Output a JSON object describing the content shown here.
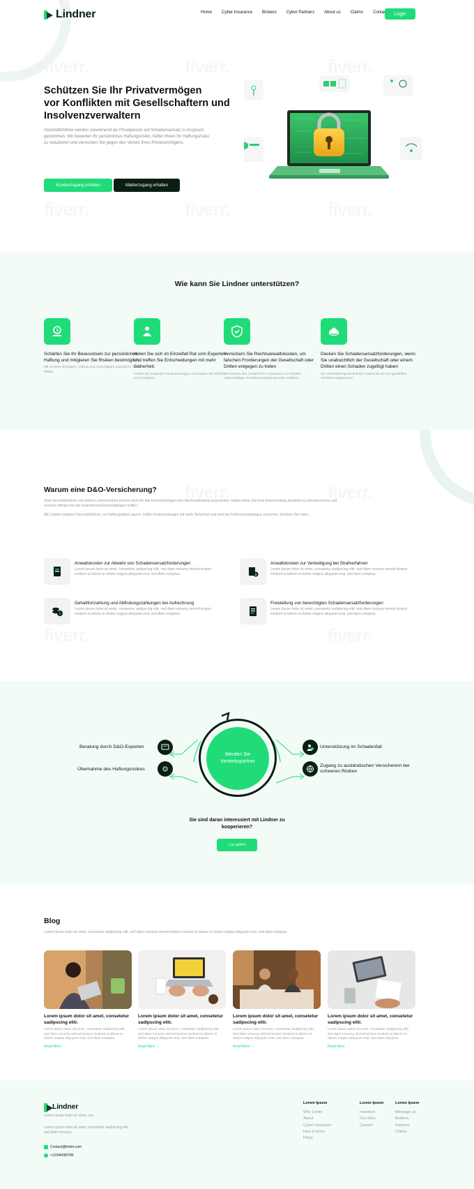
{
  "brand": {
    "name": "Lindner",
    "accent": "#1fdc78",
    "dark": "#0a1f14",
    "soft_bg": "#f3fbf7"
  },
  "nav": {
    "items": [
      "Home",
      "Cyber Insurance",
      "Brokers",
      "Cyber Partners",
      "About us",
      "Claims",
      "Contacts"
    ],
    "login": "Login"
  },
  "hero": {
    "title_lines": [
      "Schützen Sie Ihr Privatvermögen",
      "vor Konflikten mit Gesellschaftern und",
      "Insolvenzverwaltern"
    ],
    "paragraph": "Geschäftsführer werden zunehmend als Privatperson auf Schadensersatz in Anspruch genommen. Wir bewerten Ihr persönliches Haftungsrisiko, helfen Ihnen Ihr Haftungsrisiko zu reduzieren und versichern Sie gegen den Verlust Ihres Privatvermögens.",
    "btn_primary": "Kundenzugang erhalten",
    "btn_secondary": "Maklerzugang erhalten"
  },
  "help": {
    "title": "Wie kann Sie Lindner unterstützen?",
    "features": [
      {
        "title": "Schärfen Sie Ihr Bewusstsein zur persönlichen Haftung und mitigieren Sie Risiken bestmöglich.",
        "text": "Mit unseren Beiträgen, Videos und Vorschlägen reduzieren sie Ihr Risiko",
        "icon": "money-bag-icon"
      },
      {
        "title": "Holen Sie sich im Einzelfall Rat vom Experten und treffen Sie Entscheidungen mit mehr Sicherheit.",
        "text": "Finden Sie Experten mit Bewertungen und kaufen Sie einfach zum Festpreis",
        "icon": "expert-icon"
      },
      {
        "title": "Versichern Sie Rechtsanwaltskosten, um falschen Frorderungen der Gesellschaft oder Dritten entgegen zu treten",
        "text": "Sie können den Anwalt Ihres Vertrauens zur Abwehr unberechtigter Schadensersatzansprüche wählen?",
        "icon": "shield-icon"
      },
      {
        "title": "Decken Sie Schadensersatzforderungen, wenn Sie unabsichtlich der Gesellschaft oder einem Dritten einen Schaden zugefügt haben",
        "text": "Die Versicherung bezahlt die Ansprüche bis zur gewählten Versicherungssumme",
        "icon": "house-protection-icon"
      }
    ]
  },
  "why": {
    "title": "Warum eine D&O-Versicherung?",
    "p1": "Viele Geschäftsführer von kleinen Unternehmen können nicht für alle Entscheidungen eine Rechtsabteilung hinzuziehen. haben keine Zeit jede Entscheidung detailliert zu dokumentieren und müssen oftmals mit viel Unsicherheit Entscheidungen treffen.",
    "p2": "Mit Lindner erfahren Geschäftsführer, wo Haftungsfallen lauern, treffen Entscheidungen mit mehr Sicherheit und sind bei Fehlentscheidungen versichert. Erfahren Sie mehr...",
    "items": [
      {
        "title": "Anwaltskosten zur Abwehr von Schadensersatzforderungen",
        "text": "Lorem ipsum dolor sit amet, consetetur sadipscing elitr, sed diam nonumy eirmod tempor invidunt ut labore et dolore magna aliquyam erat, sed diam voluptua."
      },
      {
        "title": "Anwaltskosten zur Verteidigung bei Strafverfahren",
        "text": "Lorem ipsum dolor sit amet, consetetur sadipscing elitr, sed diam nonumy eirmod tempor invidunt ut labore et dolore magna aliquyam erat, sed diam voluptua."
      },
      {
        "title": "Gehaltfortzahlung und Abfindungszahlungen bei Aufrechnung",
        "text": "Lorem ipsum dolor sit amet, consetetur sadipscing elitr, sed diam nonumy eirmod tempor invidunt ut labore et dolore magna aliquyam erat, sed diam voluptua."
      },
      {
        "title": "Freistellung von berechtigten Schadensersatzforderungen",
        "text": "Lorem ipsum dolor sit amet, consetetur sadipscing elitr, sed diam nonumy eirmod tempor invidunt ut labore et dolore magna aliquyam erat, sed diam voluptua."
      }
    ]
  },
  "partner": {
    "center": "Werden Sie Vertriebspartner",
    "left": [
      "Beratung durch D&O-Experten",
      "Übernahme des Haftungsrisikos"
    ],
    "right": [
      "Unterstützung im Schadenfall",
      "Zugang zu ausländischen Versicherern bei schweren Risiken"
    ],
    "question": "Sie sind daran interessiert mit Lindner zu kooperieren?",
    "cta": "Los geht's"
  },
  "blog": {
    "title": "Blog",
    "intro": "Lorem ipsum dolor sit amet, consetetur sadipscing elitr, sed diam nonumy eirmod tempor invidunt ut labore et dolore magna aliquyam erat, sed diam voluptua.",
    "cards": [
      {
        "title": "Lorem ipsum dolor sit amet, consetetur sadipscing elitr.",
        "text": "Lorem ipsum dolor sit amet, consetetur sadipscing elitr, sed diam nonumy eirmod tempor invidunt ut labore et dolore magna aliquyam erat, sed diam voluptua.",
        "more": "Read More →"
      },
      {
        "title": "Lorem ipsum dolor sit amet, consetetur sadipscing elitr.",
        "text": "Lorem ipsum dolor sit amet, consetetur sadipscing elitr, sed diam nonumy eirmod tempor invidunt ut labore et dolore magna aliquyam erat, sed diam voluptua.",
        "more": "Read More →"
      },
      {
        "title": "Lorem ipsum dolor sit amet, consetetur sadipscing elitr.",
        "text": "Lorem ipsum dolor sit amet, consetetur sadipscing elitr, sed diam nonumy eirmod tempor invidunt ut labore et dolore magna aliquyam erat, sed diam voluptua.",
        "more": "Read More →"
      },
      {
        "title": "Lorem ipsum dolor sit amet, consetetur sadipscing elitr.",
        "text": "Lorem ipsum dolor sit amet, consetetur sadipscing elitr, sed diam nonumy eirmod tempor invidunt ut labore et dolore magna aliquyam erat, sed diam voluptua.",
        "more": "Read More →"
      }
    ]
  },
  "footer": {
    "brand": "Lindner",
    "tagline": "Lorem ipsum dolor sit amet, con.",
    "desc": "Lorem ipsum dolor sit amet, consetetur sadipscing elitr, sed diam nonumy.",
    "email": "Contact@linder.com",
    "phone": "+12344566780",
    "columns": [
      {
        "title": "Lorem Ipsem",
        "links": [
          "Why Linder",
          "About",
          "Cyber Insurance",
          "How it works",
          "FAQs"
        ]
      },
      {
        "title": "Lorem Ipsem",
        "links": [
          "Investors",
          "Our story",
          "Careers"
        ]
      },
      {
        "title": "Lorem Ipsem",
        "links": [
          "Message us",
          "Brokers",
          "Partners",
          "Claims"
        ]
      }
    ]
  }
}
